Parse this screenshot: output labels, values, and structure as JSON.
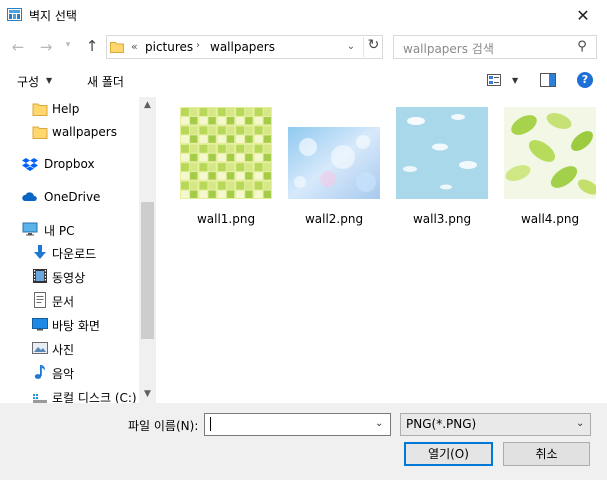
{
  "window": {
    "title": "벽지 선택"
  },
  "address": {
    "overflow": "«",
    "crumbs": [
      "pictures",
      "wallpapers"
    ],
    "search_placeholder": "wallpapers 검색"
  },
  "toolbar": {
    "organize_label": "구성",
    "new_folder_label": "새 폴더"
  },
  "nav": {
    "items": [
      {
        "label": "Help",
        "icon": "folder-icon"
      },
      {
        "label": "wallpapers",
        "icon": "folder-icon"
      },
      {
        "label": "Dropbox",
        "icon": "dropbox-icon"
      },
      {
        "label": "OneDrive",
        "icon": "onedrive-icon"
      },
      {
        "label": "내 PC",
        "icon": "pc-icon"
      },
      {
        "label": "다운로드",
        "icon": "download-icon"
      },
      {
        "label": "동영상",
        "icon": "video-icon"
      },
      {
        "label": "문서",
        "icon": "document-icon"
      },
      {
        "label": "바탕 화면",
        "icon": "desktop-icon"
      },
      {
        "label": "사진",
        "icon": "pictures-icon"
      },
      {
        "label": "음악",
        "icon": "music-icon"
      },
      {
        "label": "로컬 디스크 (C:)",
        "icon": "disk-icon"
      }
    ]
  },
  "files": [
    {
      "name": "wall1.png",
      "preview": "green-checker"
    },
    {
      "name": "wall2.png",
      "preview": "blue-bokeh"
    },
    {
      "name": "wall3.png",
      "preview": "sky-clouds"
    },
    {
      "name": "wall4.png",
      "preview": "green-leaves"
    }
  ],
  "bottom": {
    "filename_label": "파일 이름(N):",
    "filename_value": "",
    "filter_value": "PNG(*.PNG)",
    "open_label": "열기(O)",
    "cancel_label": "취소"
  },
  "colors": {
    "accent": "#0078d7",
    "help": "#1e6fd6",
    "folder": "#ffd76e"
  }
}
